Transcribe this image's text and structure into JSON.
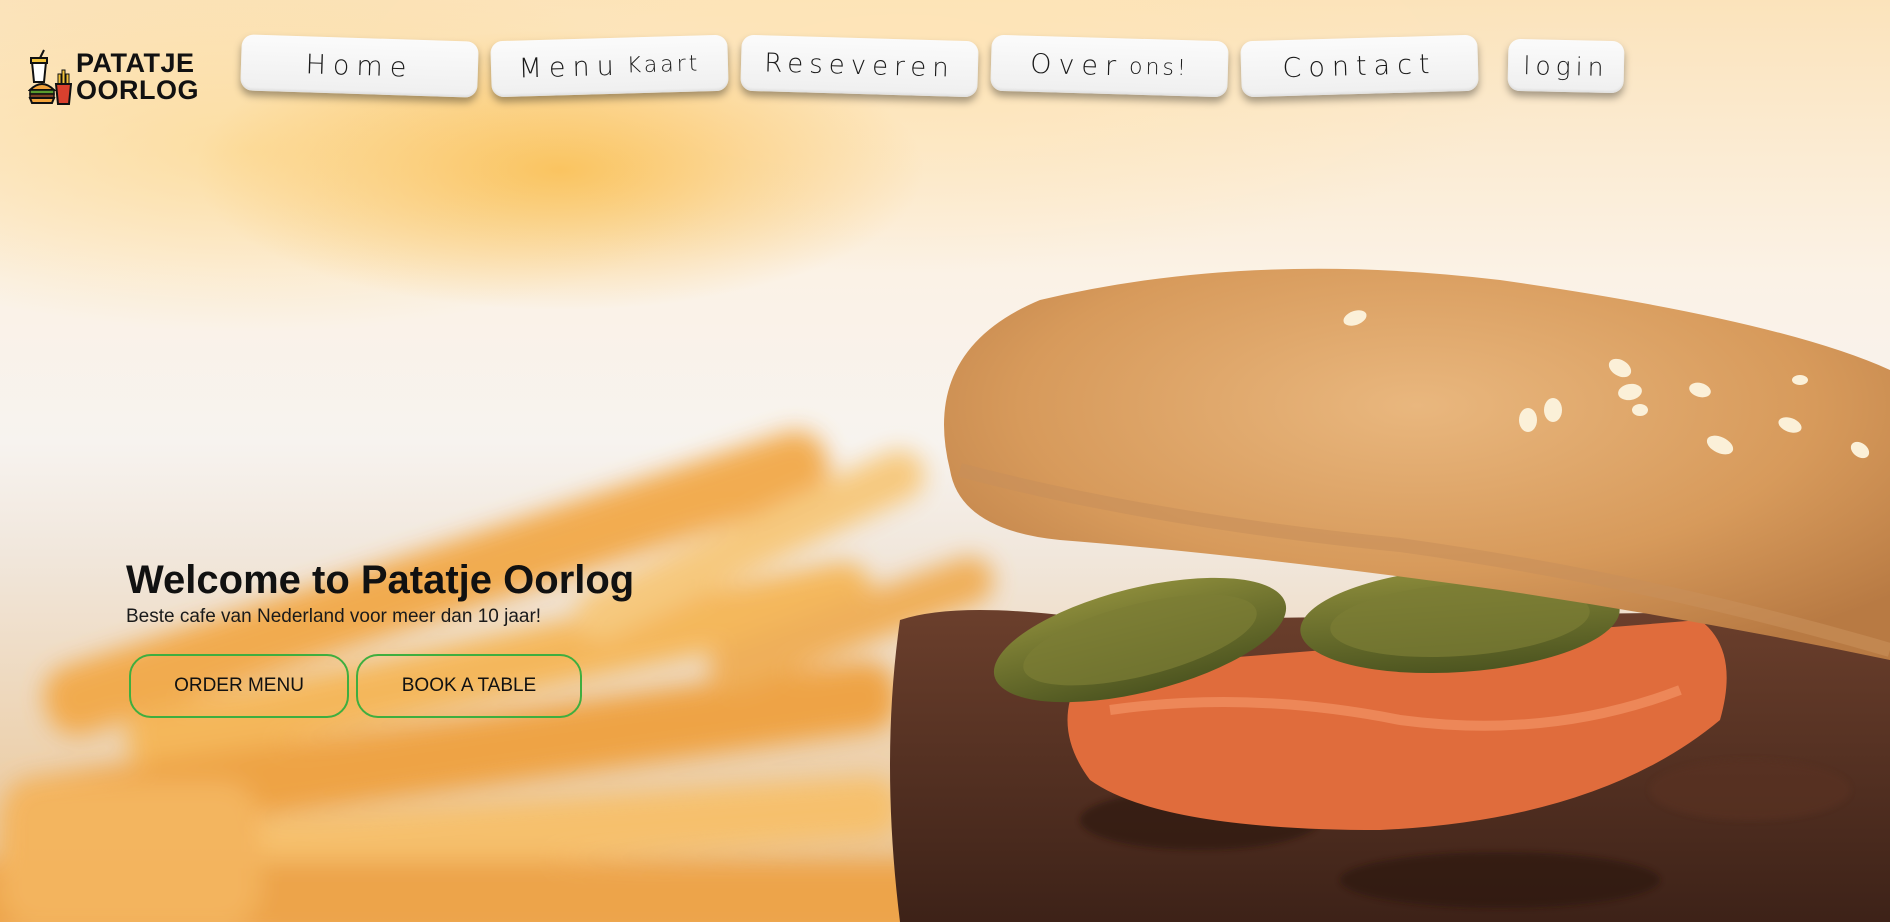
{
  "brand": {
    "line1": "PATATJE",
    "line2": "OORLOG",
    "icon": "burger-fries-drink-icon"
  },
  "nav": {
    "home": {
      "main": "Home",
      "extra": ""
    },
    "menu": {
      "main": "Menu",
      "extra": "Kaart"
    },
    "reserveren": {
      "main": "Reseveren",
      "extra": ""
    },
    "over": {
      "main": "Over",
      "extra": "ons!"
    },
    "contact": {
      "main": "Contact",
      "extra": ""
    },
    "login": {
      "main": "login",
      "extra": ""
    }
  },
  "hero": {
    "title": "Welcome to Patatje Oorlog",
    "subtitle": "Beste cafe van Nederland voor meer dan 10 jaar!",
    "order_label": "ORDER MENU",
    "book_label": "BOOK A TABLE",
    "background": "burger-and-fries-photo"
  },
  "colors": {
    "cta_border": "#3fae3f",
    "nav_bg": "#f4f4f4",
    "text": "#111111"
  }
}
